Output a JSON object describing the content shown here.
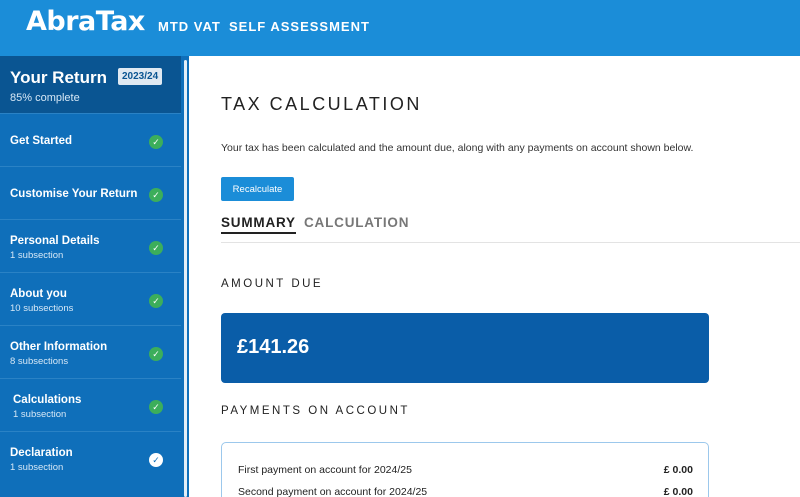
{
  "app": {
    "logo": "AbraTax",
    "logo_mark": "™",
    "nav": [
      "MTD VAT",
      "SELF ASSESSMENT"
    ]
  },
  "sidebar": {
    "title": "Your Return",
    "year": "2023/24",
    "progress": "85% complete",
    "items": [
      {
        "label": "Get Started",
        "sub": "",
        "status": "complete"
      },
      {
        "label": "Customise Your Return",
        "sub": "",
        "status": "complete"
      },
      {
        "label": "Personal Details",
        "sub": "1 subsection",
        "status": "complete"
      },
      {
        "label": "About you",
        "sub": "10 subsections",
        "status": "complete"
      },
      {
        "label": "Other Information",
        "sub": "8 subsections",
        "status": "complete"
      },
      {
        "label": "Calculations",
        "sub": "1 subsection",
        "status": "complete"
      },
      {
        "label": "Declaration",
        "sub": "1 subsection",
        "status": "current"
      }
    ]
  },
  "main": {
    "title": "TAX CALCULATION",
    "description": "Your tax has been calculated and the amount due, along with any payments on account shown below.",
    "recalculate_label": "Recalculate",
    "tabs": [
      {
        "label": "SUMMARY",
        "active": true
      },
      {
        "label": "CALCULATION",
        "active": false
      }
    ],
    "amount_due_heading": "AMOUNT DUE",
    "amount_due": "£141.26",
    "payments_heading": "PAYMENTS ON ACCOUNT",
    "payments": [
      {
        "label": "First payment on account for 2024/25",
        "value": "£ 0.00"
      },
      {
        "label": "Second payment on account for 2024/25",
        "value": "£ 0.00"
      }
    ]
  },
  "colors": {
    "brand_blue": "#1b8dd8",
    "sidebar_blue": "#0f6fba",
    "sidebar_head": "#0a5592",
    "due_card": "#0a5da8",
    "complete_green": "#3cae5b"
  },
  "icons": {
    "complete": "check-circle-green-icon",
    "current": "check-circle-white-icon"
  }
}
